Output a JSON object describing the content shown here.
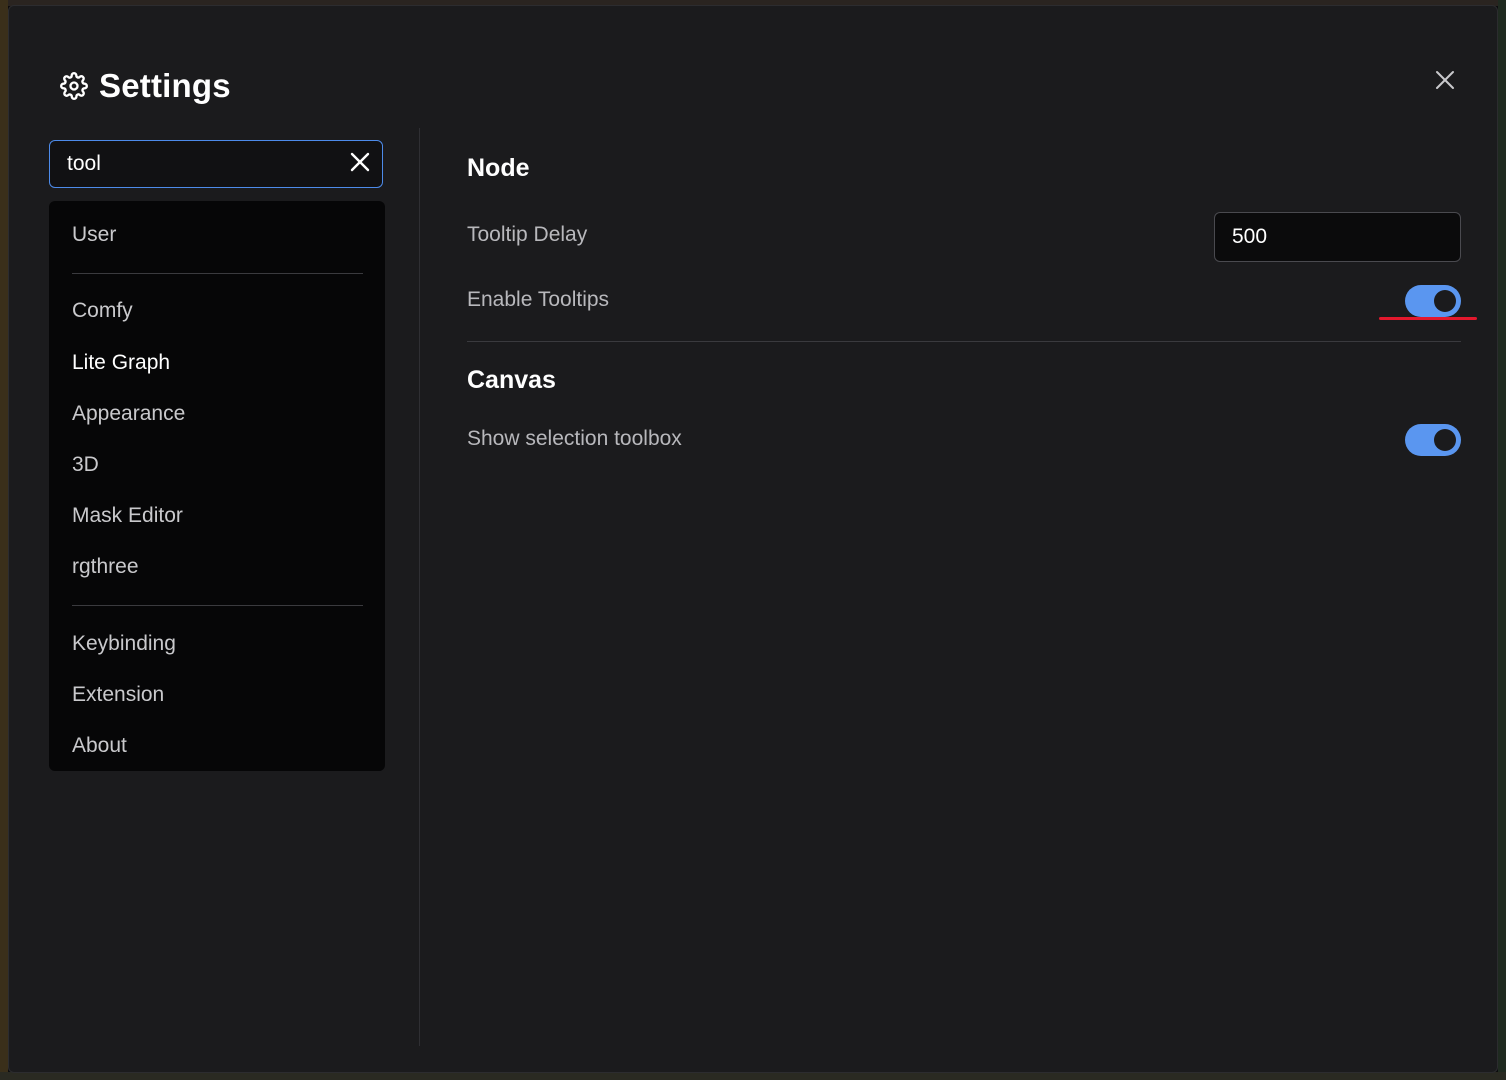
{
  "dialog": {
    "title": "Settings"
  },
  "search": {
    "value": "tool"
  },
  "nav": {
    "items": [
      {
        "label": "User",
        "active": false
      },
      {
        "label": "Comfy",
        "active": false
      },
      {
        "label": "Lite Graph",
        "active": true
      },
      {
        "label": "Appearance",
        "active": false
      },
      {
        "label": "3D",
        "active": false
      },
      {
        "label": "Mask Editor",
        "active": false
      },
      {
        "label": "rgthree",
        "active": false
      },
      {
        "label": "Keybinding",
        "active": false
      },
      {
        "label": "Extension",
        "active": false
      },
      {
        "label": "About",
        "active": false
      }
    ]
  },
  "sections": [
    {
      "title": "Node",
      "settings": [
        {
          "label": "Tooltip Delay",
          "type": "number",
          "value": "500"
        },
        {
          "label": "Enable Tooltips",
          "type": "toggle",
          "value": true
        }
      ]
    },
    {
      "title": "Canvas",
      "settings": [
        {
          "label": "Show selection toolbox",
          "type": "toggle",
          "value": true
        }
      ]
    }
  ],
  "colors": {
    "accent": "#5a96f0",
    "highlight": "#e3182d",
    "dialog_bg": "#1b1b1d",
    "nav_bg": "#060607"
  },
  "icons": {
    "title": "gear-icon",
    "close": "close-icon",
    "search_clear": "clear-icon"
  }
}
